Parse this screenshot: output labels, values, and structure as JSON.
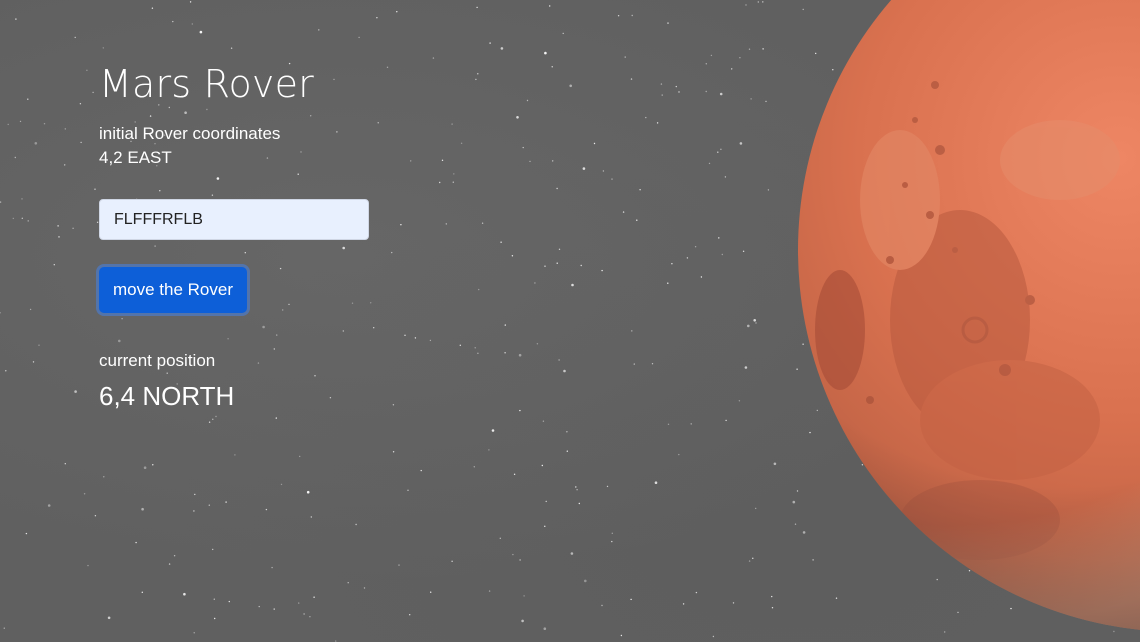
{
  "app": {
    "title": "Mars Rover"
  },
  "initial": {
    "label": "initial Rover coordinates",
    "coordinates": "4,2 EAST"
  },
  "command": {
    "value": "FLFFFRFLB"
  },
  "action": {
    "button_label": "move the Rover"
  },
  "result": {
    "label": "current position",
    "position": "6,4 NORTH"
  },
  "colors": {
    "button": "#0d5fd8",
    "input_bg": "#e8f0fe",
    "background": "#606060",
    "planet": "#d9714f"
  }
}
